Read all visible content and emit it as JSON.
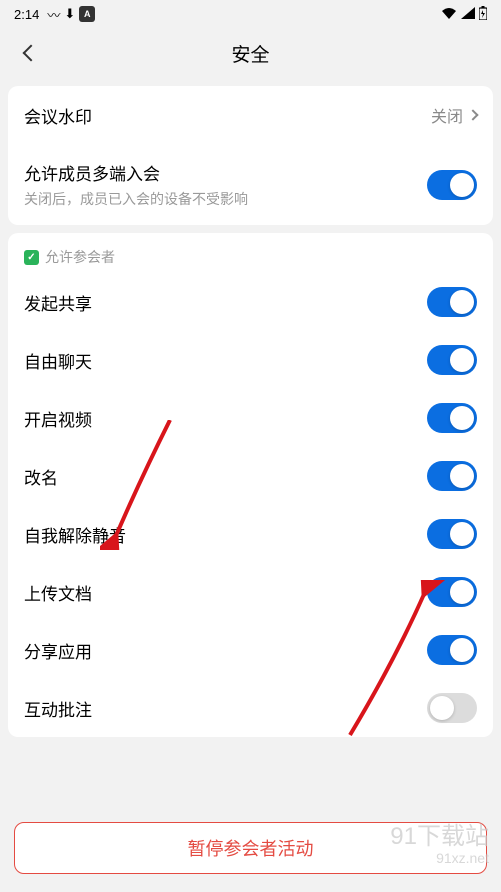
{
  "status": {
    "time": "2:14",
    "icons": [
      "M",
      "↓",
      "A"
    ]
  },
  "header": {
    "title": "安全"
  },
  "card1": {
    "watermark": {
      "label": "会议水印",
      "value": "关闭"
    },
    "multidevice": {
      "label": "允许成员多端入会",
      "sub": "关闭后，成员已入会的设备不受影响",
      "on": true
    }
  },
  "section_header": "允许参会者",
  "permissions": [
    {
      "key": "share",
      "label": "发起共享",
      "on": true
    },
    {
      "key": "chat",
      "label": "自由聊天",
      "on": true
    },
    {
      "key": "video",
      "label": "开启视频",
      "on": true
    },
    {
      "key": "rename",
      "label": "改名",
      "on": true
    },
    {
      "key": "unmute",
      "label": "自我解除静音",
      "on": true
    },
    {
      "key": "upload",
      "label": "上传文档",
      "on": true
    },
    {
      "key": "shareapp",
      "label": "分享应用",
      "on": true
    },
    {
      "key": "annotate",
      "label": "互动批注",
      "on": false
    }
  ],
  "pause_button": "暂停参会者活动",
  "annotations": {
    "arrows_point_to": "自我解除静音 toggle",
    "watermark_text": "91下载站",
    "watermark_url": "91xz.net"
  },
  "colors": {
    "accent": "#0b6ee1",
    "danger": "#e44b42",
    "success": "#2ab35a"
  }
}
